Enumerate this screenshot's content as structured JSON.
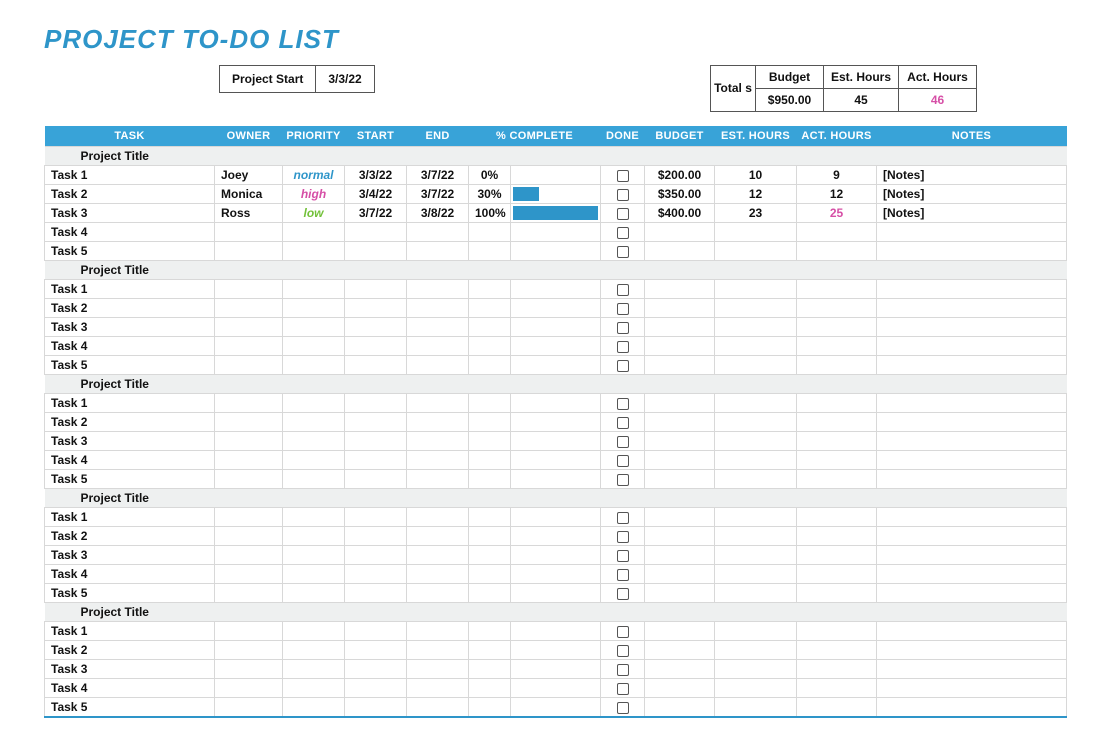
{
  "page_title": "PROJECT TO-DO LIST",
  "project_start": {
    "label": "Project Start",
    "value": "3/3/22"
  },
  "totals": {
    "label": "Total s",
    "headers": {
      "budget": "Budget",
      "est": "Est. Hours",
      "act": "Act. Hours"
    },
    "values": {
      "budget": "$950.00",
      "est": "45",
      "act": "46"
    }
  },
  "columns": {
    "task": "Task",
    "owner": "Owner",
    "priority": "Priority",
    "start": "Start",
    "end": "End",
    "pct_complete": "% Complete",
    "done": "Done",
    "budget": "Budget",
    "est_hours": "Est. Hours",
    "act_hours": "Act. Hours",
    "notes": "Notes"
  },
  "sections": [
    {
      "title": "Project Title",
      "tasks": [
        {
          "name": "Task 1",
          "owner": "Joey",
          "priority": "normal",
          "start": "3/3/22",
          "end": "3/7/22",
          "pct": 0,
          "done": false,
          "budget": "$200.00",
          "est": "10",
          "act": "9",
          "act_accent": false,
          "notes": "[Notes]"
        },
        {
          "name": "Task 2",
          "owner": "Monica",
          "priority": "high",
          "start": "3/4/22",
          "end": "3/7/22",
          "pct": 30,
          "done": false,
          "budget": "$350.00",
          "est": "12",
          "act": "12",
          "act_accent": false,
          "notes": "[Notes]"
        },
        {
          "name": "Task 3",
          "owner": "Ross",
          "priority": "low",
          "start": "3/7/22",
          "end": "3/8/22",
          "pct": 100,
          "done": false,
          "budget": "$400.00",
          "est": "23",
          "act": "25",
          "act_accent": true,
          "notes": "[Notes]"
        },
        {
          "name": "Task 4"
        },
        {
          "name": "Task 5"
        }
      ]
    },
    {
      "title": "Project Title",
      "tasks": [
        {
          "name": "Task 1"
        },
        {
          "name": "Task 2"
        },
        {
          "name": "Task 3"
        },
        {
          "name": "Task 4"
        },
        {
          "name": "Task 5"
        }
      ]
    },
    {
      "title": "Project Title",
      "tasks": [
        {
          "name": "Task 1"
        },
        {
          "name": "Task 2"
        },
        {
          "name": "Task 3"
        },
        {
          "name": "Task 4"
        },
        {
          "name": "Task 5"
        }
      ]
    },
    {
      "title": "Project Title",
      "tasks": [
        {
          "name": "Task 1"
        },
        {
          "name": "Task 2"
        },
        {
          "name": "Task 3"
        },
        {
          "name": "Task 4"
        },
        {
          "name": "Task 5"
        }
      ]
    },
    {
      "title": "Project Title",
      "tasks": [
        {
          "name": "Task 1"
        },
        {
          "name": "Task 2"
        },
        {
          "name": "Task 3"
        },
        {
          "name": "Task 4"
        },
        {
          "name": "Task 5"
        }
      ]
    }
  ]
}
